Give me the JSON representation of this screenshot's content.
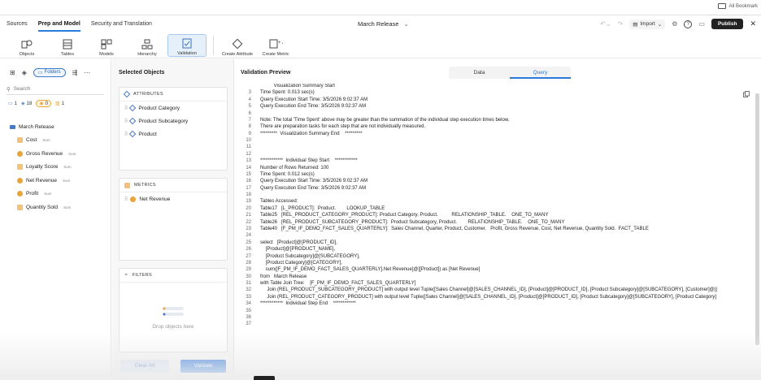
{
  "browser": {
    "bookmarks_label": "All Bookmark"
  },
  "nav": {
    "tabs": [
      {
        "label": "Sources"
      },
      {
        "label": "Prep and Model"
      },
      {
        "label": "Security and Translation"
      }
    ],
    "doc_title": "March Release",
    "import_label": "Import",
    "publish_label": "Publish"
  },
  "toolbar": {
    "tools": [
      {
        "label": "Objects",
        "icon": "objects-icon"
      },
      {
        "label": "Tables",
        "icon": "tables-icon"
      },
      {
        "label": "Models",
        "icon": "models-icon"
      },
      {
        "label": "Hierarchy",
        "icon": "hierarchy-icon"
      },
      {
        "label": "Validation",
        "icon": "validation-icon"
      },
      {
        "label": "Create Attribute",
        "icon": "create-attribute-icon"
      },
      {
        "label": "Create Metric",
        "icon": "create-metric-icon"
      }
    ]
  },
  "left": {
    "folders_label": "Folders",
    "search_placeholder": "Search",
    "counts": [
      "1",
      "18",
      "0",
      "1"
    ],
    "root": "March Release",
    "items": [
      {
        "label": "Cost",
        "agg": "Sum"
      },
      {
        "label": "Gross Revenue",
        "agg": "Sum"
      },
      {
        "label": "Loyalty Score",
        "agg": "Sum"
      },
      {
        "label": "Net Revenue",
        "agg": "Sum"
      },
      {
        "label": "Profit",
        "agg": "Sum"
      },
      {
        "label": "Quantity Sold",
        "agg": "Sum"
      }
    ]
  },
  "mid": {
    "title": "Selected Objects",
    "attributes_header": "ATTRIBUTES",
    "attributes": [
      "Product Category",
      "Product Subcategory",
      "Product"
    ],
    "metrics_header": "METRICS",
    "metrics": [
      "Net Revenue"
    ],
    "filters_header": "FILTERS",
    "drop_text": "Drop objects here",
    "clear_label": "Clear All",
    "validate_label": "Validate"
  },
  "preview": {
    "title": "Validation Preview",
    "tabs": [
      "Data",
      "Query"
    ],
    "active_tab": "Query",
    "lines": [
      {
        "n": "",
        "t": "          Visualization Summary Start"
      },
      {
        "n": "3",
        "t": "Time Spent: 0.013 sec(s)"
      },
      {
        "n": "4",
        "t": "Query Execution Start Time: 3/5/2026 9:02:37 AM"
      },
      {
        "n": "5",
        "t": "Query Execution End Time: 3/5/2026 9:02:37 AM"
      },
      {
        "n": "6",
        "t": ""
      },
      {
        "n": "7",
        "t": "Note: The total 'Time Spent' above may be greater than the summation of the individual step execution times below."
      },
      {
        "n": "8",
        "t": "There are preparation tasks for each step that are not individually measured."
      },
      {
        "n": "9",
        "t": "*********  Visualization Summary End    *********"
      },
      {
        "n": "10",
        "t": ""
      },
      {
        "n": "11",
        "t": ""
      },
      {
        "n": "12",
        "t": ""
      },
      {
        "n": "13",
        "t": "************  Individual Step Start    ************"
      },
      {
        "n": "14",
        "t": "Number of Rows Returned: 100"
      },
      {
        "n": "15",
        "t": "Time Spent: 0.012 sec(s)"
      },
      {
        "n": "16",
        "t": "Query Execution Start Time: 3/5/2026 9:02:37 AM"
      },
      {
        "n": "17",
        "t": "Query Execution End Time: 3/5/2026 9:02:37 AM"
      },
      {
        "n": "18",
        "t": ""
      },
      {
        "n": "19",
        "t": "Tables Accessed:"
      },
      {
        "n": "20",
        "t": "Table17   [L_PRODUCT]:  Product.        LOOKUP_TABLE"
      },
      {
        "n": "21",
        "t": "Table25   [REL_PRODUCT_CATEGORY_PRODUCT]: Product Category, Product.          RELATIONSHIP_TABLE.    ONE_TO_MANY"
      },
      {
        "n": "22",
        "t": "Table26   [REL_PRODUCT_SUBCATEGORY_PRODUCT]:  Product Subcategory, Product.        RELATIONSHIP_TABLE.    ONE_TO_MANY"
      },
      {
        "n": "23",
        "t": "Table40   [F_PM_IF_DEMO_FACT_SALES_QUARTERLY]:  Sales Channel, Quarter, Product, Customer.   Profit, Gross Revenue, Cost, Net Revenue, Quantity Sold.  FACT_TABLE"
      },
      {
        "n": "24",
        "t": ""
      },
      {
        "n": "25",
        "t": "select   [Product]@[PRODUCT_ID],"
      },
      {
        "n": "26",
        "t": "    [Product]@[PRODUCT_NAME],"
      },
      {
        "n": "27",
        "t": "    [Product Subcategory]@[SUBCATEGORY],"
      },
      {
        "n": "28",
        "t": "    [Product Category]@[CATEGORY],"
      },
      {
        "n": "29",
        "t": "    sum([F_PM_IF_DEMO_FACT_SALES_QUARTERLY].Net Revenue]@[[Product]) as [Net Revenue]"
      },
      {
        "n": "30",
        "t": "from   March Release"
      },
      {
        "n": "31",
        "t": "with Table Join Tree:    [F_PM_IF_DEMO_FACT_SALES_QUARTERLY]"
      },
      {
        "n": "32",
        "t": "     Join (REL_PRODUCT_SUBCATEGORY_PRODUCT] with output level Tuple([Sales Channel]@[SALES_CHANNEL_ID], [Product]@[PRODUCT_ID], [Product Subcategory]@[SUBCATEGORY], [Customer]@[("
      },
      {
        "n": "33",
        "t": "     Join (REL_PRODUCT_CATEGORY_PRODUCT] with output level Tuple([Sales Channel]@[SALES_CHANNEL_ID], [Product]@[PRODUCT_ID], [Product Subcategory]@[SUBCATEGORY], [Product Category]"
      },
      {
        "n": "34",
        "t": "************  Individual Step End    ************"
      },
      {
        "n": "35",
        "t": ""
      },
      {
        "n": "36",
        "t": ""
      },
      {
        "n": "37",
        "t": ""
      }
    ]
  }
}
